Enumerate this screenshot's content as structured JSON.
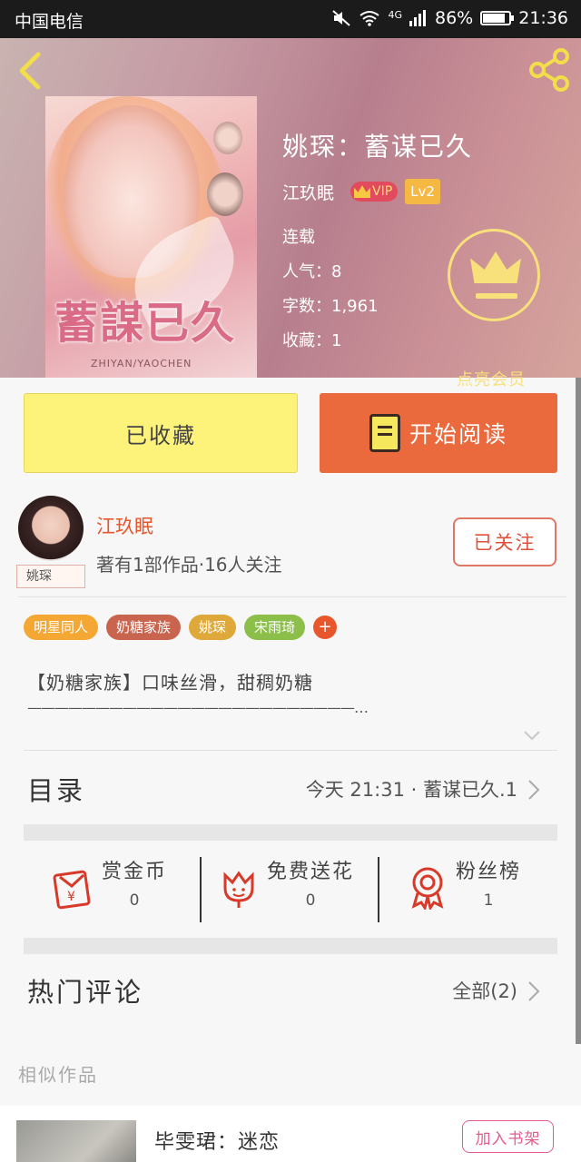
{
  "status_bar": {
    "carrier": "中国电信",
    "network": "4G",
    "battery": "86%",
    "time": "21:36"
  },
  "book": {
    "title": "姚琛：蓄谋已久",
    "author": "江玖眠",
    "vip_label": "VIP",
    "level": "Lv2",
    "status": "连载",
    "popularity": "人气：8",
    "word_count": "字数：1,961",
    "favorites": "收藏：1",
    "cover_title": "蓄謀已久",
    "cover_subtitle": "ZHIYAN/YAOCHEN"
  },
  "vip_promo": {
    "label": "点亮会员"
  },
  "actions": {
    "collected_label": "已收藏",
    "read_label": "开始阅读"
  },
  "author_block": {
    "name": "江玖眠",
    "description": "著有1部作品·16人关注",
    "avatar_tag": "姚琛",
    "follow_label": "已关注"
  },
  "tags": [
    {
      "label": "明星同人",
      "color": "#f4a833"
    },
    {
      "label": "奶糖家族",
      "color": "#c9654f"
    },
    {
      "label": "姚琛",
      "color": "#dea83a"
    },
    {
      "label": "宋雨琦",
      "color": "#8bbf4a"
    }
  ],
  "tag_more": "+",
  "intro": {
    "line1": "【奶糖家族】口味丝滑，甜稠奶糖",
    "line2": "————————————————————————…"
  },
  "toc": {
    "label": "目录",
    "latest": "今天 21:31 · 蓄谋已久.1"
  },
  "stats": [
    {
      "title": "赏金币",
      "value": "0"
    },
    {
      "title": "免费送花",
      "value": "0"
    },
    {
      "title": "粉丝榜",
      "value": "1"
    }
  ],
  "comments": {
    "label": "热门评论",
    "all": "全部(2)"
  },
  "similar": {
    "label": "相似作品",
    "items": [
      {
        "name": "毕雯珺：迷恋",
        "action": "加入书架"
      }
    ]
  },
  "colors": {
    "accent_orange": "#ea6a3d",
    "collected_yellow": "#fdf37a",
    "author_red": "#e8562c",
    "vip_gold": "#f8e07a",
    "add_pink": "#e25b91"
  }
}
